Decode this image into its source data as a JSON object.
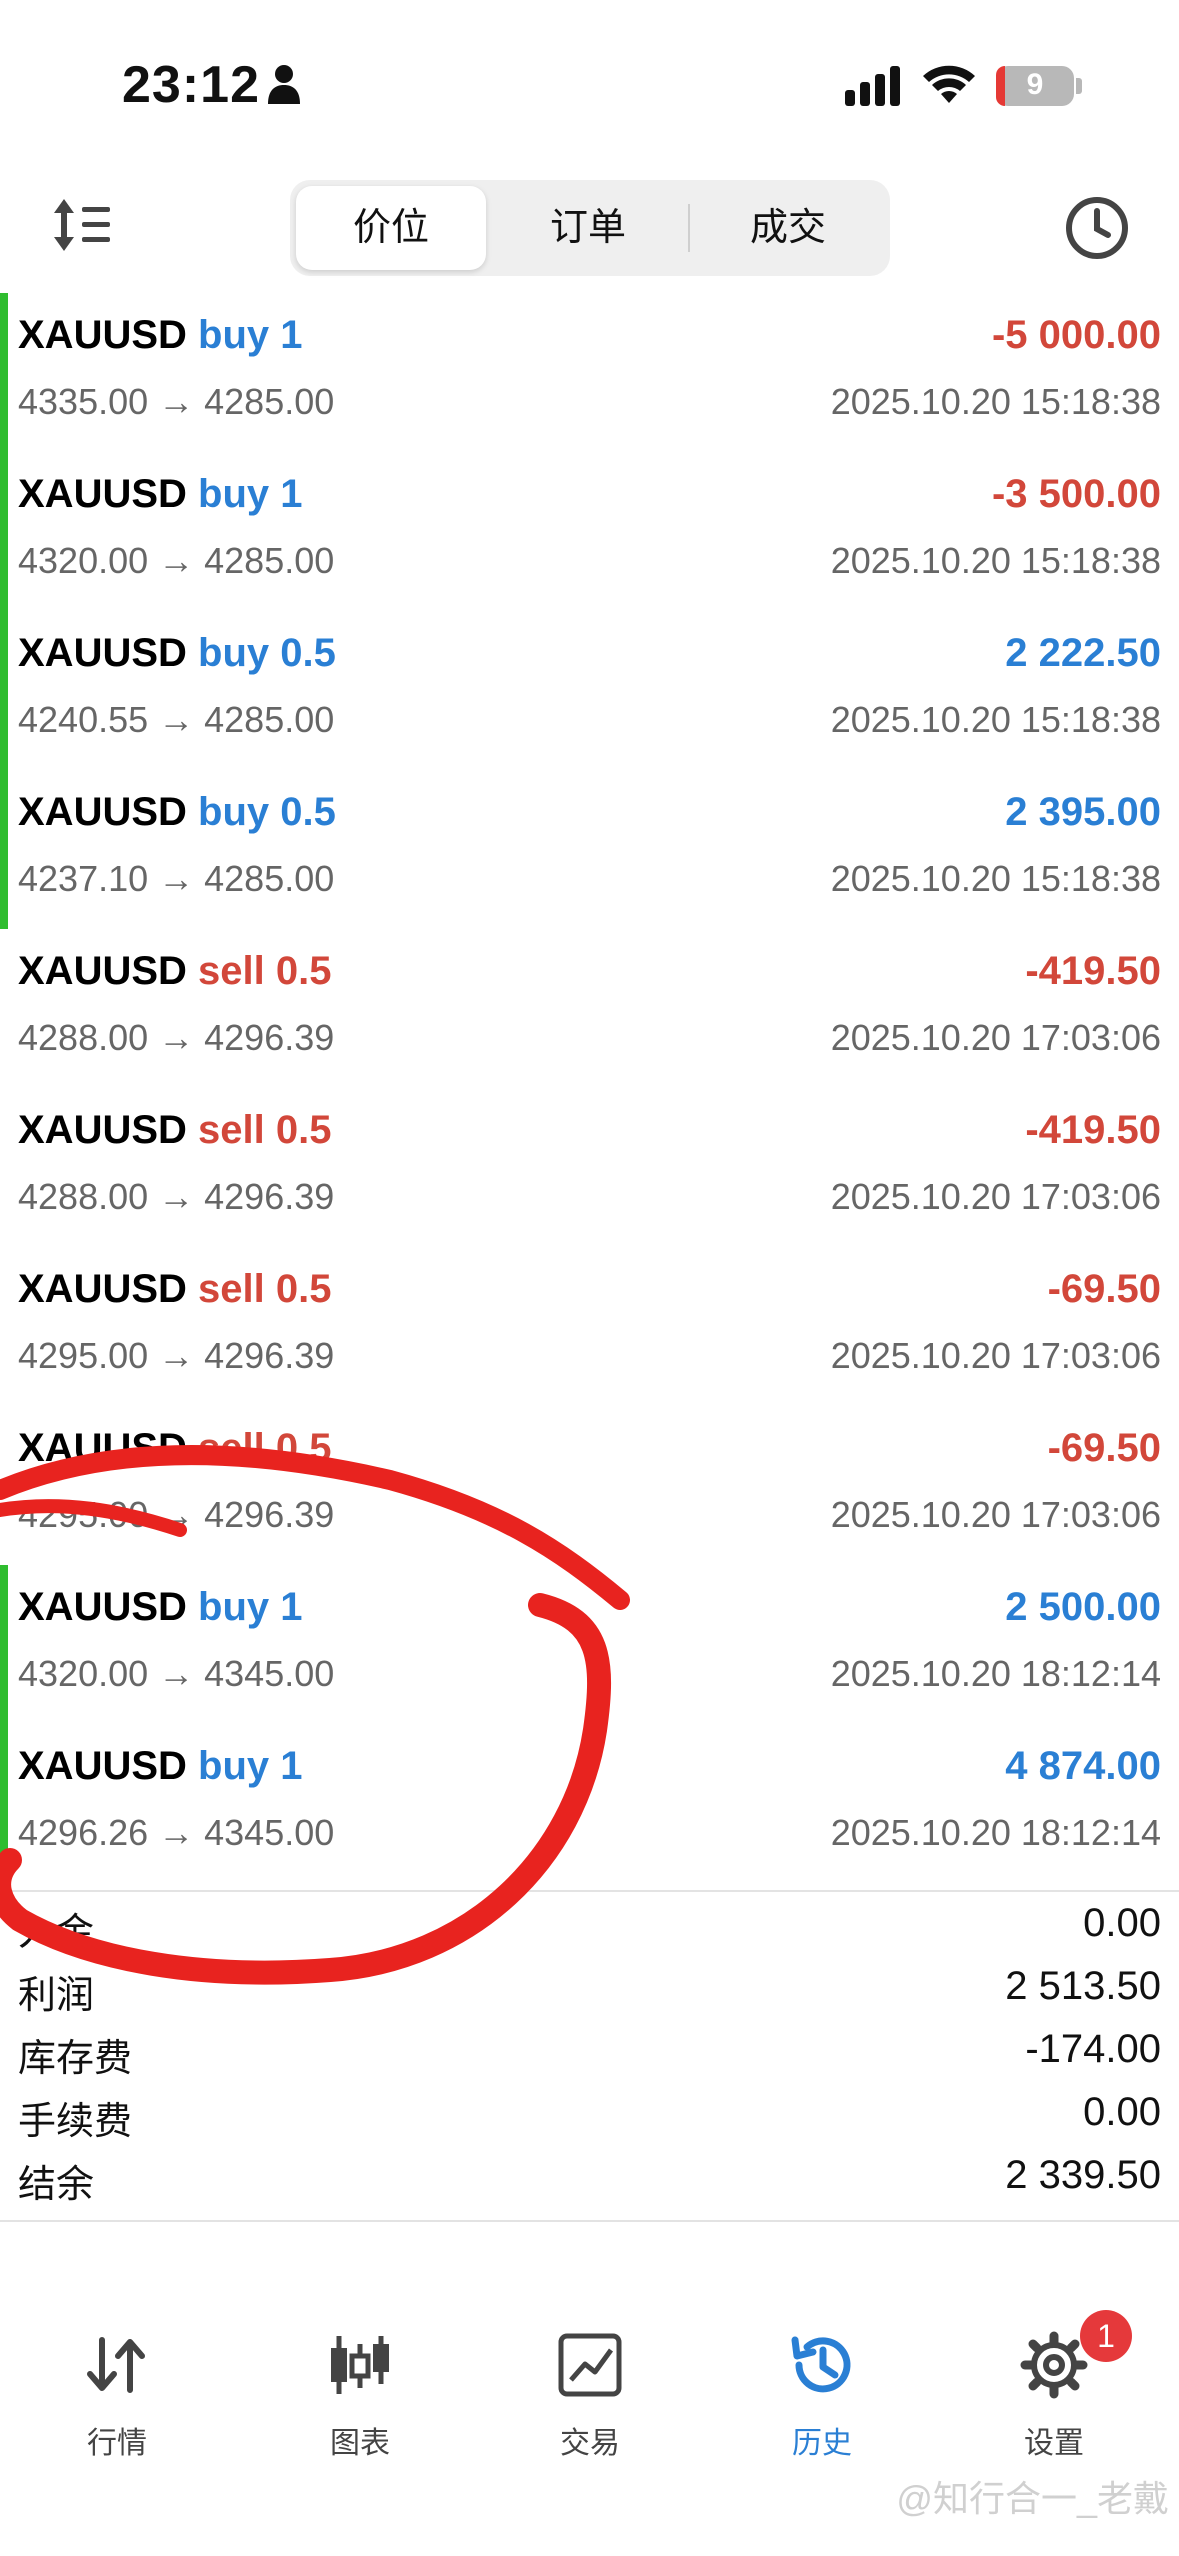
{
  "status_bar": {
    "time": "23:12",
    "battery": "9"
  },
  "header": {
    "tabs": [
      {
        "label": "价位",
        "active": true
      },
      {
        "label": "订单",
        "active": false
      },
      {
        "label": "成交",
        "active": false
      }
    ]
  },
  "deals": [
    {
      "symbol": "XAUUSD",
      "side": "buy 1",
      "type": "buy",
      "profit": "-5 000.00",
      "profit_sign": "neg",
      "prices": "4335.00 → 4285.00",
      "datetime": "2025.10.20 15:18:38",
      "bar": true
    },
    {
      "symbol": "XAUUSD",
      "side": "buy 1",
      "type": "buy",
      "profit": "-3 500.00",
      "profit_sign": "neg",
      "prices": "4320.00 → 4285.00",
      "datetime": "2025.10.20 15:18:38",
      "bar": true
    },
    {
      "symbol": "XAUUSD",
      "side": "buy 0.5",
      "type": "buy",
      "profit": "2 222.50",
      "profit_sign": "pos",
      "prices": "4240.55 → 4285.00",
      "datetime": "2025.10.20 15:18:38",
      "bar": true
    },
    {
      "symbol": "XAUUSD",
      "side": "buy 0.5",
      "type": "buy",
      "profit": "2 395.00",
      "profit_sign": "pos",
      "prices": "4237.10 → 4285.00",
      "datetime": "2025.10.20 15:18:38",
      "bar": true
    },
    {
      "symbol": "XAUUSD",
      "side": "sell 0.5",
      "type": "sell",
      "profit": "-419.50",
      "profit_sign": "neg",
      "prices": "4288.00 → 4296.39",
      "datetime": "2025.10.20 17:03:06",
      "bar": false
    },
    {
      "symbol": "XAUUSD",
      "side": "sell 0.5",
      "type": "sell",
      "profit": "-419.50",
      "profit_sign": "neg",
      "prices": "4288.00 → 4296.39",
      "datetime": "2025.10.20 17:03:06",
      "bar": false
    },
    {
      "symbol": "XAUUSD",
      "side": "sell 0.5",
      "type": "sell",
      "profit": "-69.50",
      "profit_sign": "neg",
      "prices": "4295.00 → 4296.39",
      "datetime": "2025.10.20 17:03:06",
      "bar": false
    },
    {
      "symbol": "XAUUSD",
      "side": "sell 0.5",
      "type": "sell",
      "profit": "-69.50",
      "profit_sign": "neg",
      "prices": "4295.00 → 4296.39",
      "datetime": "2025.10.20 17:03:06",
      "bar": false
    },
    {
      "symbol": "XAUUSD",
      "side": "buy 1",
      "type": "buy",
      "profit": "2 500.00",
      "profit_sign": "pos",
      "prices": "4320.00 → 4345.00",
      "datetime": "2025.10.20 18:12:14",
      "bar": true
    },
    {
      "symbol": "XAUUSD",
      "side": "buy 1",
      "type": "buy",
      "profit": "4 874.00",
      "profit_sign": "pos",
      "prices": "4296.26 → 4345.00",
      "datetime": "2025.10.20 18:12:14",
      "bar": true
    }
  ],
  "summary": [
    {
      "label": "入金",
      "value": "0.00"
    },
    {
      "label": "利润",
      "value": "2 513.50"
    },
    {
      "label": "库存费",
      "value": "-174.00"
    },
    {
      "label": "手续费",
      "value": "0.00"
    },
    {
      "label": "结余",
      "value": "2 339.50"
    }
  ],
  "tabbar": {
    "items": [
      {
        "label": "行情",
        "icon": "quotes-icon",
        "active": false
      },
      {
        "label": "图表",
        "icon": "chart-icon",
        "active": false
      },
      {
        "label": "交易",
        "icon": "trade-icon",
        "active": false
      },
      {
        "label": "历史",
        "icon": "history-icon",
        "active": true
      },
      {
        "label": "设置",
        "icon": "settings-icon",
        "active": false
      }
    ],
    "settings_badge": "1"
  },
  "watermark": "@知行合一_老戴",
  "colors": {
    "buy": "#2a7fd4",
    "sell": "#d2473a",
    "bar": "#2fbd2f",
    "annotation": "#e8231f"
  }
}
